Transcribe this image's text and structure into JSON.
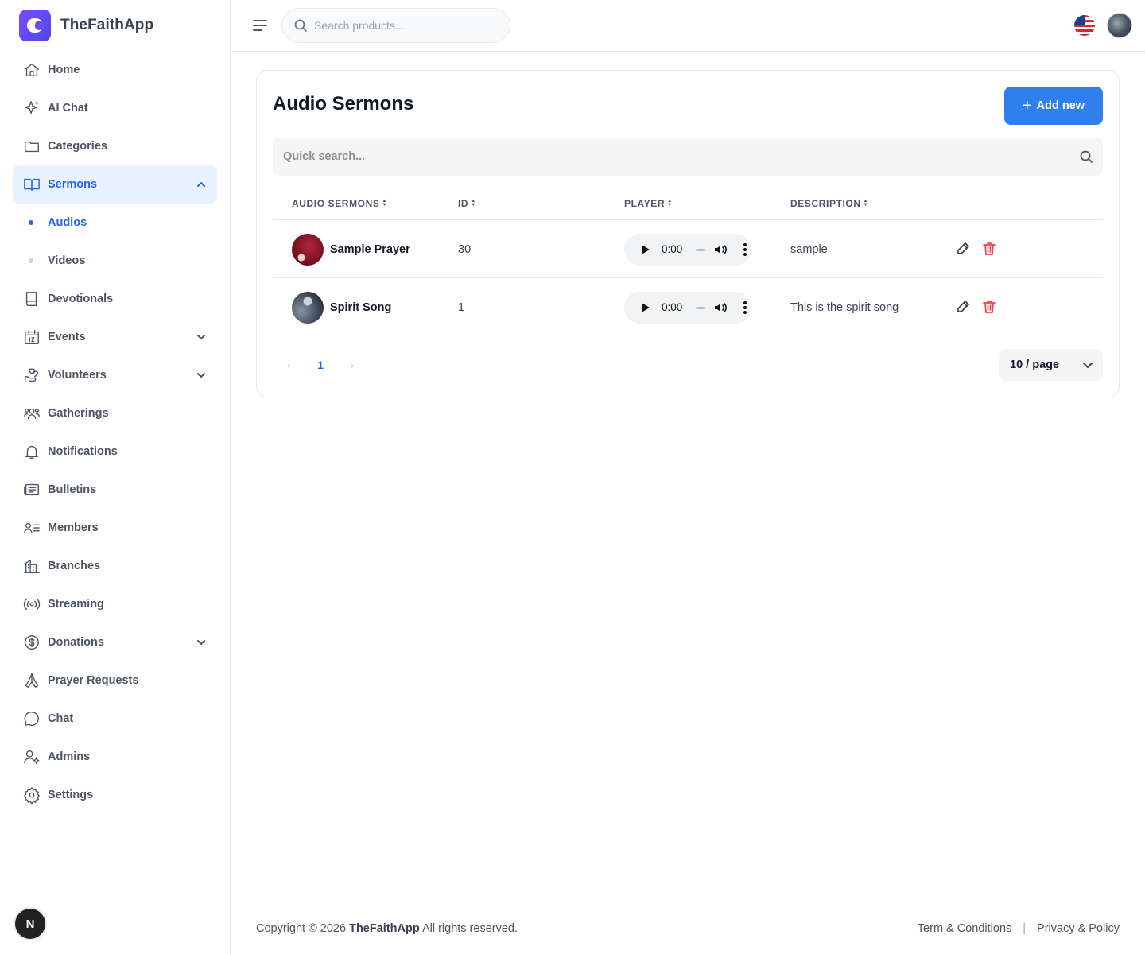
{
  "brand": {
    "name": "TheFaithApp"
  },
  "sidebar": {
    "items": [
      {
        "label": "Home",
        "icon": "home-icon"
      },
      {
        "label": "AI Chat",
        "icon": "sparkle-icon"
      },
      {
        "label": "Categories",
        "icon": "folder-icon"
      },
      {
        "label": "Sermons",
        "icon": "book-open-icon",
        "active": true,
        "expanded": true,
        "children": [
          {
            "label": "Audios",
            "active": true
          },
          {
            "label": "Videos"
          }
        ]
      },
      {
        "label": "Devotionals",
        "icon": "book-icon"
      },
      {
        "label": "Events",
        "icon": "calendar-icon",
        "collapsible": true
      },
      {
        "label": "Volunteers",
        "icon": "hand-heart-icon",
        "collapsible": true
      },
      {
        "label": "Gatherings",
        "icon": "users-icon"
      },
      {
        "label": "Notifications",
        "icon": "bell-icon"
      },
      {
        "label": "Bulletins",
        "icon": "newspaper-icon"
      },
      {
        "label": "Members",
        "icon": "user-list-icon"
      },
      {
        "label": "Branches",
        "icon": "building-icon"
      },
      {
        "label": "Streaming",
        "icon": "broadcast-icon"
      },
      {
        "label": "Donations",
        "icon": "dollar-icon",
        "collapsible": true
      },
      {
        "label": "Prayer Requests",
        "icon": "praying-hands-icon"
      },
      {
        "label": "Chat",
        "icon": "chat-bubble-icon"
      },
      {
        "label": "Admins",
        "icon": "user-gear-icon"
      },
      {
        "label": "Settings",
        "icon": "gear-icon"
      }
    ],
    "fab_label": "N"
  },
  "header": {
    "search_placeholder": "Search products...",
    "language_icon": "us-flag-icon"
  },
  "main": {
    "title": "Audio Sermons",
    "add_button_label": "Add new",
    "quick_search_placeholder": "Quick search...",
    "columns": [
      "AUDIO SERMONS",
      "ID",
      "PLAYER",
      "DESCRIPTION"
    ],
    "rows": [
      {
        "name": "Sample Prayer",
        "id": "30",
        "player_time": "0:00",
        "description": "sample"
      },
      {
        "name": "Spirit Song",
        "id": "1",
        "player_time": "0:00",
        "description": "This is the spirit song"
      }
    ],
    "pagination": {
      "prev": "‹",
      "current": "1",
      "next": "›",
      "page_size": "10 / page"
    }
  },
  "footer": {
    "copyright_prefix": "Copyright © 2026",
    "brand": "TheFaithApp",
    "copyright_suffix": "All rights reserved.",
    "link_terms": "Term & Conditions",
    "link_separator": "|",
    "link_privacy": "Privacy & Policy"
  },
  "colors": {
    "accent": "#2f80ed",
    "active_bg": "#e8f1ff",
    "danger": "#ef4444"
  }
}
